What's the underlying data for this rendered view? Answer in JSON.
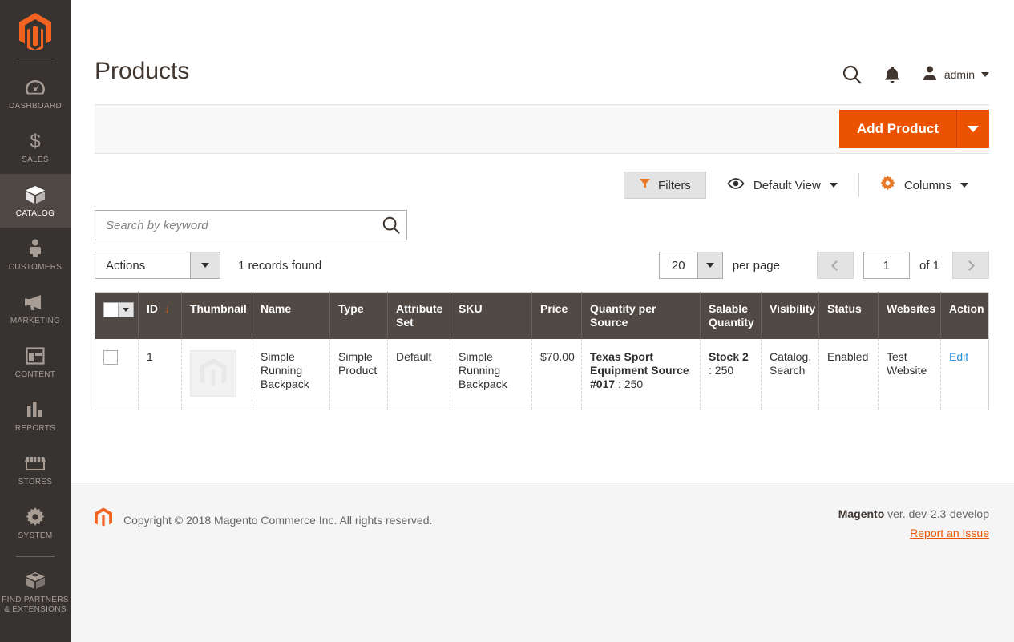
{
  "sidebar": {
    "logo_name": "magento-logo",
    "items": [
      {
        "label": "Dashboard",
        "icon": "dashboard-icon",
        "active": false
      },
      {
        "label": "Sales",
        "icon": "dollar-icon",
        "active": false
      },
      {
        "label": "Catalog",
        "icon": "box-icon",
        "active": true
      },
      {
        "label": "Customers",
        "icon": "person-icon",
        "active": false
      },
      {
        "label": "Marketing",
        "icon": "megaphone-icon",
        "active": false
      },
      {
        "label": "Content",
        "icon": "layout-icon",
        "active": false
      },
      {
        "label": "Reports",
        "icon": "bar-chart-icon",
        "active": false
      },
      {
        "label": "Stores",
        "icon": "storefront-icon",
        "active": false
      },
      {
        "label": "System",
        "icon": "gear-icon",
        "active": false
      },
      {
        "label": "Find Partners & Extensions",
        "icon": "extension-icon",
        "active": false
      }
    ]
  },
  "header": {
    "title": "Products",
    "search_icon": "search-icon",
    "notifications_icon": "bell-icon",
    "account_icon": "user-avatar-icon",
    "account_name": "admin"
  },
  "page_actions": {
    "add_product_label": "Add Product",
    "add_product_toggle_icon": "caret-down-icon"
  },
  "toolbar": {
    "filters_label": "Filters",
    "filters_icon": "funnel-icon",
    "view_label": "Default View",
    "view_icon": "eye-icon",
    "columns_label": "Columns",
    "columns_icon": "gear-icon"
  },
  "search": {
    "placeholder": "Search by keyword",
    "value": "",
    "button_icon": "search-icon"
  },
  "grid_controls": {
    "actions_label": "Actions",
    "records_found": "1 records found",
    "per_page_value": "20",
    "per_page_label": "per page",
    "page_value": "1",
    "of_label": "of 1",
    "prev_icon": "chevron-left-icon",
    "next_icon": "chevron-right-icon"
  },
  "grid": {
    "select_all_icon": "caret-down-icon",
    "sort_icon": "arrow-down-icon",
    "columns": [
      {
        "label": "",
        "key": "checkbox"
      },
      {
        "label": "ID",
        "key": "id",
        "sorted": true
      },
      {
        "label": "Thumbnail",
        "key": "thumbnail"
      },
      {
        "label": "Name",
        "key": "name"
      },
      {
        "label": "Type",
        "key": "type"
      },
      {
        "label": "Attribute Set",
        "key": "attribute_set"
      },
      {
        "label": "SKU",
        "key": "sku"
      },
      {
        "label": "Price",
        "key": "price"
      },
      {
        "label": "Quantity per Source",
        "key": "qty_per_source"
      },
      {
        "label": "Salable Quantity",
        "key": "salable_qty"
      },
      {
        "label": "Visibility",
        "key": "visibility"
      },
      {
        "label": "Status",
        "key": "status"
      },
      {
        "label": "Websites",
        "key": "websites"
      },
      {
        "label": "Action",
        "key": "action"
      }
    ],
    "rows": [
      {
        "id": "1",
        "thumbnail_icon": "product-placeholder-icon",
        "name": "Simple Running Backpack",
        "type": "Simple Product",
        "attribute_set": "Default",
        "sku": "Simple Running Backpack",
        "price": "$70.00",
        "qty_source_name": "Texas Sport Equipment Source #017",
        "qty_source_sep": " : ",
        "qty_source_value": "250",
        "salable_stock_name": "Stock 2",
        "salable_sep": " : ",
        "salable_value": "250",
        "visibility": "Catalog, Search",
        "status": "Enabled",
        "websites": "Test Website",
        "action": "Edit"
      }
    ]
  },
  "footer": {
    "logo_icon": "magento-logo",
    "copyright": "Copyright © 2018 Magento Commerce Inc. All rights reserved.",
    "brand": "Magento",
    "version": " ver. dev-2.3-develop",
    "report_link": "Report an Issue"
  },
  "colors": {
    "accent": "#eb5202",
    "sidebar": "#373330",
    "table_header": "#514943",
    "link": "#2391dc"
  }
}
